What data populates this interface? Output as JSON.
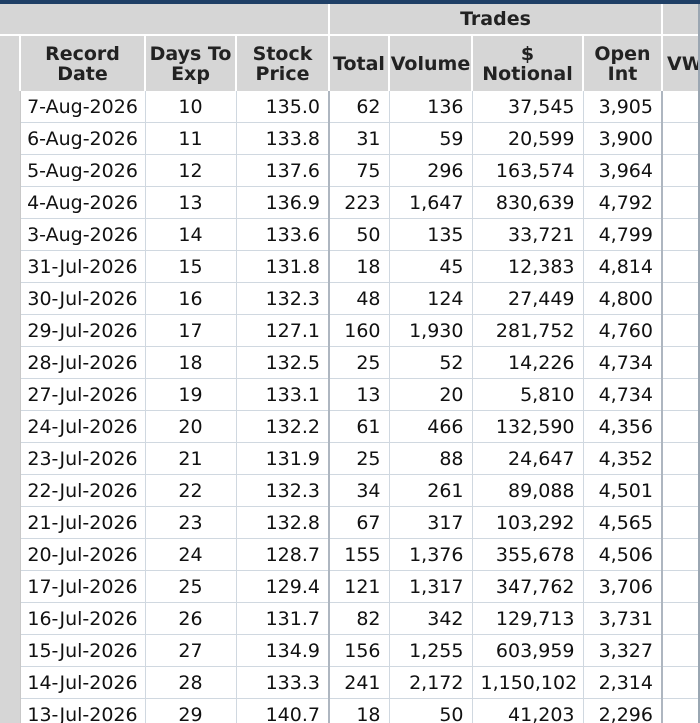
{
  "table": {
    "group_header": "Trades",
    "columns": {
      "record_date": "Record Date",
      "days_to_exp": "Days To Exp",
      "stock_price": "Stock Price",
      "total": "Total",
      "volume": "Volume",
      "notional": "$ Notional",
      "open_int": "Open Int",
      "vw": "VW"
    },
    "rows": [
      {
        "date": "7-Aug-2026",
        "days": "10",
        "price": "135.0",
        "total": "62",
        "volume": "136",
        "notional": "37,545",
        "oi": "3,905"
      },
      {
        "date": "6-Aug-2026",
        "days": "11",
        "price": "133.8",
        "total": "31",
        "volume": "59",
        "notional": "20,599",
        "oi": "3,900"
      },
      {
        "date": "5-Aug-2026",
        "days": "12",
        "price": "137.6",
        "total": "75",
        "volume": "296",
        "notional": "163,574",
        "oi": "3,964"
      },
      {
        "date": "4-Aug-2026",
        "days": "13",
        "price": "136.9",
        "total": "223",
        "volume": "1,647",
        "notional": "830,639",
        "oi": "4,792"
      },
      {
        "date": "3-Aug-2026",
        "days": "14",
        "price": "133.6",
        "total": "50",
        "volume": "135",
        "notional": "33,721",
        "oi": "4,799"
      },
      {
        "date": "31-Jul-2026",
        "days": "15",
        "price": "131.8",
        "total": "18",
        "volume": "45",
        "notional": "12,383",
        "oi": "4,814"
      },
      {
        "date": "30-Jul-2026",
        "days": "16",
        "price": "132.3",
        "total": "48",
        "volume": "124",
        "notional": "27,449",
        "oi": "4,800"
      },
      {
        "date": "29-Jul-2026",
        "days": "17",
        "price": "127.1",
        "total": "160",
        "volume": "1,930",
        "notional": "281,752",
        "oi": "4,760"
      },
      {
        "date": "28-Jul-2026",
        "days": "18",
        "price": "132.5",
        "total": "25",
        "volume": "52",
        "notional": "14,226",
        "oi": "4,734"
      },
      {
        "date": "27-Jul-2026",
        "days": "19",
        "price": "133.1",
        "total": "13",
        "volume": "20",
        "notional": "5,810",
        "oi": "4,734"
      },
      {
        "date": "24-Jul-2026",
        "days": "20",
        "price": "132.2",
        "total": "61",
        "volume": "466",
        "notional": "132,590",
        "oi": "4,356"
      },
      {
        "date": "23-Jul-2026",
        "days": "21",
        "price": "131.9",
        "total": "25",
        "volume": "88",
        "notional": "24,647",
        "oi": "4,352"
      },
      {
        "date": "22-Jul-2026",
        "days": "22",
        "price": "132.3",
        "total": "34",
        "volume": "261",
        "notional": "89,088",
        "oi": "4,501"
      },
      {
        "date": "21-Jul-2026",
        "days": "23",
        "price": "132.8",
        "total": "67",
        "volume": "317",
        "notional": "103,292",
        "oi": "4,565"
      },
      {
        "date": "20-Jul-2026",
        "days": "24",
        "price": "128.7",
        "total": "155",
        "volume": "1,376",
        "notional": "355,678",
        "oi": "4,506"
      },
      {
        "date": "17-Jul-2026",
        "days": "25",
        "price": "129.4",
        "total": "121",
        "volume": "1,317",
        "notional": "347,762",
        "oi": "3,706"
      },
      {
        "date": "16-Jul-2026",
        "days": "26",
        "price": "131.7",
        "total": "82",
        "volume": "342",
        "notional": "129,713",
        "oi": "3,731"
      },
      {
        "date": "15-Jul-2026",
        "days": "27",
        "price": "134.9",
        "total": "156",
        "volume": "1,255",
        "notional": "603,959",
        "oi": "3,327"
      },
      {
        "date": "14-Jul-2026",
        "days": "28",
        "price": "133.3",
        "total": "241",
        "volume": "2,172",
        "notional": "1,150,102",
        "oi": "2,314"
      },
      {
        "date": "13-Jul-2026",
        "days": "29",
        "price": "140.7",
        "total": "18",
        "volume": "50",
        "notional": "41,203",
        "oi": "2,296"
      }
    ]
  },
  "colors": {
    "header_bg": "#d6d6d6",
    "top_rule": "#1f3f66",
    "grid_line": "#d0d8e0"
  }
}
